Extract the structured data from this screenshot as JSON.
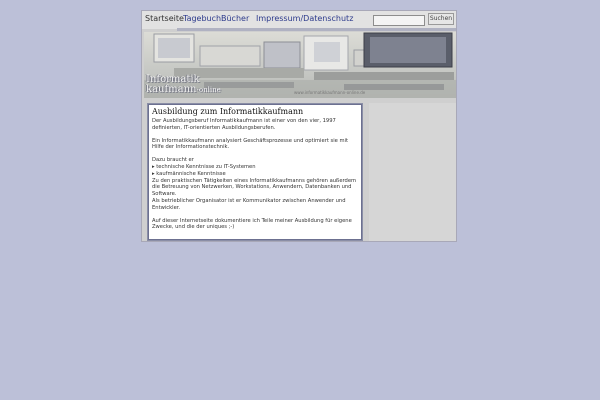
{
  "nav": {
    "items": [
      {
        "label": "Startseite"
      },
      {
        "label": "Tagebuch"
      },
      {
        "label": "Bücher"
      },
      {
        "label": "Impressum/Datenschutz"
      }
    ]
  },
  "search": {
    "value": "",
    "placeholder": "",
    "button_label": "Suchen"
  },
  "banner": {
    "logo_line1": "Informatik",
    "logo_line2": "kaufmann",
    "logo_suffix": "-online",
    "tagline": "www.informatikkaufmann-online.de"
  },
  "content": {
    "title": "Ausbildung zum Informatikkaufmann",
    "intro": "Der Ausbildungsberuf Informatikkaufmann ist einer von den vier, 1997 definierten, IT-orientierten Ausbildungsberufen.",
    "p2": "Ein Informatikkaufmann analysiert Geschäftsprozesse und optimiert sie mit Hilfe der Informationstechnik.",
    "p3": "Dazu braucht er",
    "bullets": [
      "technische Kenntnisse zu IT-Systemen",
      "kaufmännische Kenntnisse"
    ],
    "p4": "Zu den praktischen Tätigkeiten eines Informatikkaufmanns gehören außerdem die Betreuung von Netzwerken, Workstations, Anwendern, Datenbanken und Software.",
    "p5": "Als betrieblicher Organisator ist er Kommunikator zwischen Anwender und Entwickler.",
    "p6": "Auf dieser Internetseite dokumentiere ich Teile meiner Ausbildung für eigene Zwecke, und die der uniques ;-)"
  },
  "colors": {
    "background": "#bcc0d8",
    "nav_link": "#2c3a8c",
    "content_border": "#8a8ea6"
  }
}
